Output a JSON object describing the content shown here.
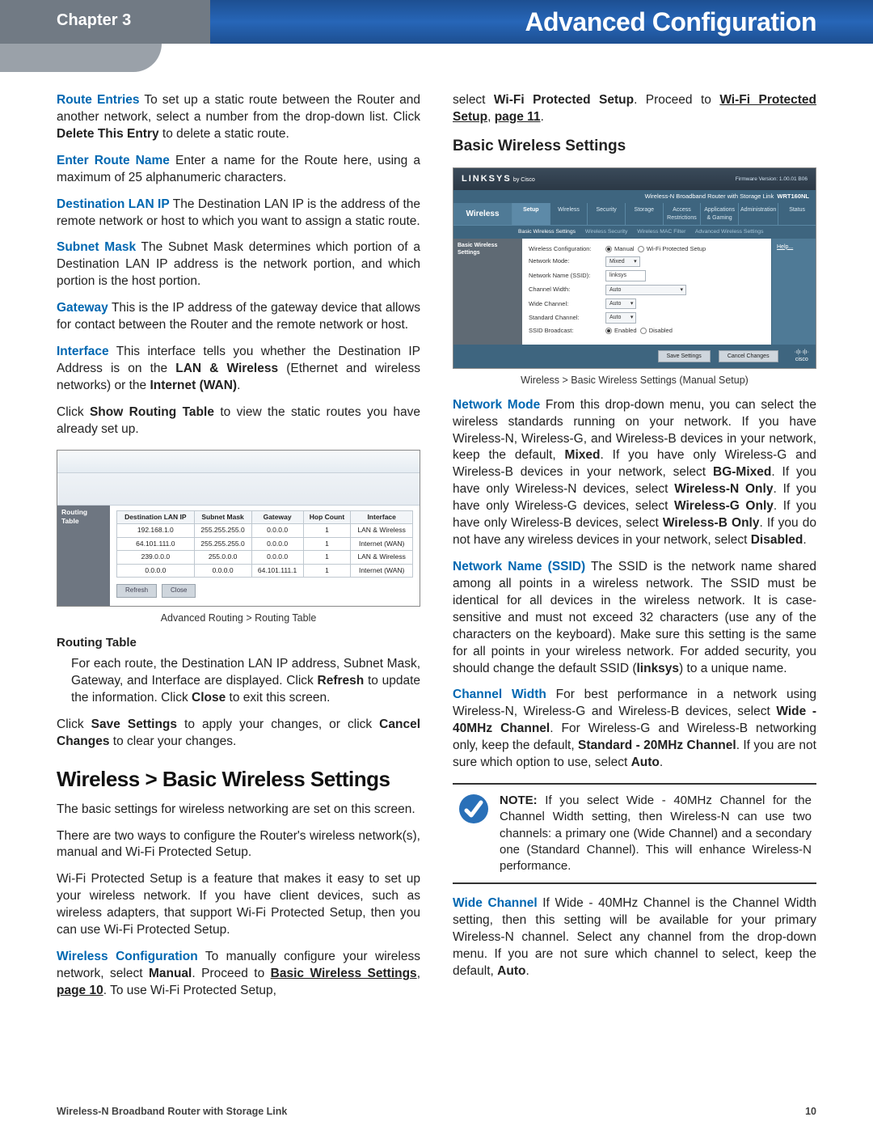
{
  "header": {
    "chapter": "Chapter 3",
    "title": "Advanced Configuration"
  },
  "left": {
    "p1": {
      "label": "Route Entries",
      "t1": "  To set up a static route between the Router and another network, select a number from the drop-down list. Click ",
      "b1": "Delete This Entry",
      "t2": " to delete a static route."
    },
    "p2": {
      "label": "Enter Route Name",
      "t1": " Enter a name for the Route here, using a maximum of 25 alphanumeric characters."
    },
    "p3": {
      "label": "Destination LAN IP",
      "t1": "  The Destination LAN IP is the address of the remote network or host to which you want to assign a static route."
    },
    "p4": {
      "label": "Subnet Mask",
      "t1": " The Subnet Mask determines which portion of a Destination LAN IP address is the network portion, and which portion is the host portion."
    },
    "p5": {
      "label": "Gateway",
      "t1": "  This is the IP address of the gateway device that allows for contact between the Router and the remote network or host."
    },
    "p6": {
      "label": "Interface",
      "t1": "  This interface tells you whether the Destination IP Address is on the ",
      "b1": "LAN & Wireless",
      "t2": " (Ethernet and wireless networks) or the ",
      "b2": "Internet (WAN)",
      "t3": "."
    },
    "p7": {
      "t1": "Click ",
      "b1": "Show Routing Table",
      "t2": " to view the static routes you have already set up."
    },
    "rt": {
      "sidelabel": "Routing Table",
      "headers": [
        "Destination LAN IP",
        "Subnet Mask",
        "Gateway",
        "Hop Count",
        "Interface"
      ],
      "rows": [
        [
          "192.168.1.0",
          "255.255.255.0",
          "0.0.0.0",
          "1",
          "LAN & Wireless"
        ],
        [
          "64.101.111.0",
          "255.255.255.0",
          "0.0.0.0",
          "1",
          "Internet (WAN)"
        ],
        [
          "239.0.0.0",
          "255.0.0.0",
          "0.0.0.0",
          "1",
          "LAN & Wireless"
        ],
        [
          "0.0.0.0",
          "0.0.0.0",
          "64.101.111.1",
          "1",
          "Internet (WAN)"
        ]
      ],
      "buttons": {
        "refresh": "Refresh",
        "close": "Close"
      }
    },
    "figcap1": "Advanced Routing > Routing Table",
    "rt_heading": "Routing Table",
    "p8": {
      "t1": "For each route, the Destination LAN IP address, Subnet Mask, Gateway, and Interface are displayed. Click ",
      "b1": "Refresh",
      "t2": " to update the information. Click ",
      "b2": "Close",
      "t3": " to exit this screen."
    },
    "p9": {
      "t1": "Click ",
      "b1": "Save Settings",
      "t2": " to apply your changes, or click ",
      "b2": "Cancel Changes",
      "t3": " to clear your changes."
    },
    "h2_wireless": "Wireless > Basic Wireless Settings",
    "p10": "The basic settings for wireless networking are set on this screen.",
    "p11": "There are two ways to configure the Router's wireless network(s), manual and Wi-Fi Protected Setup.",
    "p12": "Wi-Fi Protected Setup is a feature that makes it easy to set up your wireless network. If you have client devices, such as wireless adapters, that support Wi-Fi Protected Setup, then you can use Wi-Fi Protected Setup.",
    "p13": {
      "label": "Wireless Configuration",
      "t1": " To manually configure your wireless network, select ",
      "b1": "Manual",
      "t2": ". Proceed to ",
      "link1": "Basic Wireless Settings",
      "link2": "page 10",
      "t3": ". To use Wi-Fi Protected Setup, "
    }
  },
  "right": {
    "p0": {
      "t1": "select ",
      "b1": "Wi-Fi Protected Setup",
      "t2": ". Proceed to ",
      "link1": "Wi-Fi Protected Setup",
      "link2": "page 11",
      "t3": "."
    },
    "h3_basic": "Basic Wireless Settings",
    "wl": {
      "brand": "LINKSYS",
      "by": "by Cisco",
      "fw": "Firmware Version: 1.00.01 B06",
      "titlebar_left": "Wireless-N Broadband Router with Storage Link",
      "titlebar_right": "WRT160NL",
      "leftlabel": "Wireless",
      "tabs": [
        "Setup",
        "Wireless",
        "Security",
        "Storage",
        "Access Restrictions",
        "Applications & Gaming",
        "Administration",
        "Status"
      ],
      "subtabs": {
        "active": "Basic Wireless Settings",
        "others": [
          "Wireless Security",
          "Wireless MAC Filter",
          "Advanced Wireless Settings"
        ]
      },
      "sidelabel": "Basic Wireless Settings",
      "help": "Help...",
      "form": {
        "config_label": "Wireless Configuration:",
        "config_manual": "Manual",
        "config_wps": "Wi-Fi Protected Setup",
        "mode_label": "Network Mode:",
        "mode_val": "Mixed",
        "ssid_label": "Network Name (SSID):",
        "ssid_val": "linksys",
        "cw_label": "Channel Width:",
        "cw_val": "Auto",
        "wch_label": "Wide Channel:",
        "wch_val": "Auto",
        "sch_label": "Standard Channel:",
        "sch_val": "Auto",
        "bcast_label": "SSID Broadcast:",
        "bcast_en": "Enabled",
        "bcast_dis": "Disabled"
      },
      "buttons": {
        "save": "Save Settings",
        "cancel": "Cancel Changes"
      },
      "cisco": "cisco"
    },
    "figcap2": "Wireless > Basic Wireless Settings (Manual Setup)",
    "p1": {
      "label": "Network Mode",
      "t1": " From this drop-down menu, you can select the wireless standards running on your network. If you have Wireless-N, Wireless-G, and Wireless-B devices in your network, keep the default, ",
      "b1": "Mixed",
      "t2": ". If you have only Wireless-G and Wireless-B devices in your network, select ",
      "b2": "BG-Mixed",
      "t3": ". If you have only Wireless-N devices, select ",
      "b3": "Wireless-N Only",
      "t4": ". If you have only Wireless-G devices, select ",
      "b4": "Wireless-G Only",
      "t5": ". If you have only Wireless-B devices, select ",
      "b5": "Wireless-B Only",
      "t6": ". If you do not have any wireless devices in your network, select ",
      "b6": "Disabled",
      "t7": "."
    },
    "p2": {
      "label": "Network Name (SSID)",
      "t1": " The SSID is the network name shared among all points in a wireless network. The SSID must be identical for all devices in the wireless network. It is case-sensitive and must not exceed 32 characters (use any of the characters on the keyboard). Make sure this setting is the same for all points in your wireless network. For added security, you should change the default SSID (",
      "b1": "linksys",
      "t2": ") to a unique name."
    },
    "p3": {
      "label": "Channel Width",
      "t1": "  For best performance in a network using Wireless-N, Wireless-G and Wireless-B devices, select ",
      "b1": "Wide - 40MHz Channel",
      "t2": ". For Wireless-G and Wireless-B networking only, keep the default, ",
      "b2": "Standard - 20MHz Channel",
      "t3": ". If you are not sure which option to use, select ",
      "b3": "Auto",
      "t4": "."
    },
    "note": {
      "label": "NOTE:",
      "t1": " If you select Wide - 40MHz Channel for the Channel Width setting, then Wireless-N can use two channels: a primary one (Wide Channel) and a secondary one (Standard Channel). This will enhance Wireless-N performance."
    },
    "p4": {
      "label": "Wide Channel",
      "t1": "  If Wide - 40MHz Channel is the Channel Width setting, then this setting will be available for your primary Wireless-N channel. Select any channel from the drop-down menu. If you are not sure which channel to select, keep the default, ",
      "b1": "Auto",
      "t2": "."
    }
  },
  "footer": {
    "product": "Wireless-N Broadband Router with Storage Link",
    "page": "10"
  }
}
